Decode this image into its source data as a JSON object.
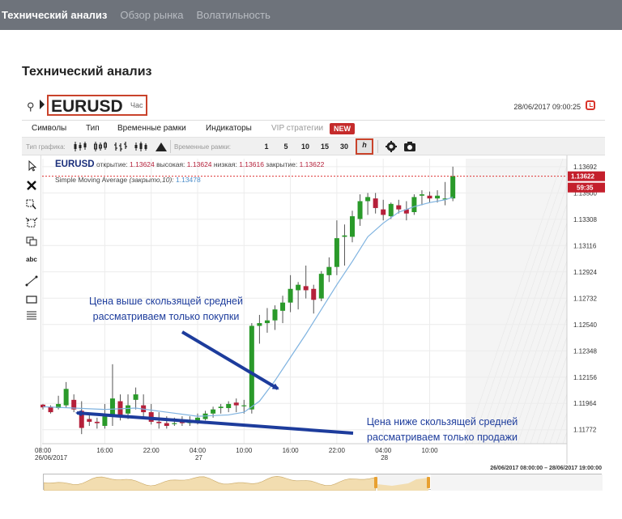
{
  "topnav": {
    "tabs": [
      {
        "label": "Технический анализ",
        "active": true
      },
      {
        "label": "Обзор рынка",
        "active": false
      },
      {
        "label": "Волатильность",
        "active": false
      }
    ]
  },
  "page_title": "Технический анализ",
  "widget": {
    "symbol": "EURUSD",
    "interval": "Час",
    "datetime": "28/06/2017 09:00:25",
    "menu": [
      "Символы",
      "Тип",
      "Временные рамки",
      "Индикаторы",
      "VIP стратегии"
    ],
    "new_badge": "NEW",
    "toolbar": {
      "chart_type_label": "Тип графика:",
      "timeframe_label": "Временные рамки:",
      "timeframes": [
        "1",
        "5",
        "10",
        "15",
        "30",
        "h"
      ],
      "selected_timeframe": "h"
    },
    "left_tools": [
      "cursor-icon",
      "cross-icon",
      "zoom-select-icon",
      "zoom-out-icon",
      "copy-icon",
      "text-tool",
      "trendline-icon",
      "rectangle-icon",
      "fib-icon"
    ],
    "text_tool_label": "abc"
  },
  "legend": {
    "symbol": "EURUSD",
    "open_label": "открытие:",
    "open": "1.13624",
    "high_label": "высокая:",
    "high": "1.13624",
    "low_label": "низкая:",
    "low": "1.13616",
    "close_label": "закрытие:",
    "close": "1.13622",
    "sma_label": "Simple Moving Average",
    "sma_params": "(закрыто,10)",
    "sma_value": "1.13478"
  },
  "price_tags": {
    "last": "1.13622",
    "countdown": "59:35"
  },
  "nav_range": "26/06/2017 08:00:00 – 28/06/2017 19:00:00",
  "annotations": {
    "upper": [
      "Цена выше скользящей средней",
      "рассматриваем только покупки"
    ],
    "lower": [
      "Цена ниже скользящей средней",
      "рассматриваем только продажи"
    ]
  },
  "colors": {
    "up": "#2a9a2a",
    "down": "#b5203a",
    "sma": "#7fb3e0",
    "arrow": "#1d3c9c",
    "accent": "#c9432b"
  },
  "chart_data": {
    "type": "candlestick",
    "symbol": "EURUSD",
    "y_ticks": [
      1.13692,
      1.135,
      1.13308,
      1.13116,
      1.12924,
      1.12732,
      1.1254,
      1.12348,
      1.12156,
      1.11964,
      1.11772
    ],
    "y_labels": [
      "1.13692",
      "1.13500",
      "1.13308",
      "1.13116",
      "1.12924",
      "1.12732",
      "1.12540",
      "1.12348",
      "1.12156",
      "1.11964",
      "1.11772"
    ],
    "ylim": [
      1.1167,
      1.1375
    ],
    "x_labels": [
      {
        "index": 0,
        "time": "08:00",
        "date": "26/06/2017"
      },
      {
        "index": 8,
        "time": "16:00",
        "date": ""
      },
      {
        "index": 14,
        "time": "22:00",
        "date": ""
      },
      {
        "index": 20,
        "time": "04:00",
        "date": "27"
      },
      {
        "index": 26,
        "time": "10:00",
        "date": ""
      },
      {
        "index": 32,
        "time": "16:00",
        "date": ""
      },
      {
        "index": 38,
        "time": "22:00",
        "date": ""
      },
      {
        "index": 44,
        "time": "04:00",
        "date": "28"
      },
      {
        "index": 50,
        "time": "10:00",
        "date": ""
      }
    ],
    "candles": [
      [
        1.11955,
        1.1196,
        1.11935,
        1.1192
      ],
      [
        1.1194,
        1.1195,
        1.119,
        1.1189
      ],
      [
        1.1193,
        1.1202,
        1.1196,
        1.1192
      ],
      [
        1.1195,
        1.1212,
        1.1207,
        1.1193
      ],
      [
        1.1199,
        1.1203,
        1.1192,
        1.119
      ],
      [
        1.1191,
        1.1198,
        1.11785,
        1.1174
      ],
      [
        1.1185,
        1.1189,
        1.1183,
        1.118
      ],
      [
        1.1183,
        1.1186,
        1.1182,
        1.1178
      ],
      [
        1.118,
        1.1196,
        1.1187,
        1.1178
      ],
      [
        1.1187,
        1.1225,
        1.12,
        1.118
      ],
      [
        1.1198,
        1.1203,
        1.1188,
        1.1184
      ],
      [
        1.1189,
        1.1203,
        1.1195,
        1.1185
      ],
      [
        1.1199,
        1.1208,
        1.1203,
        1.1192
      ],
      [
        1.1195,
        1.1203,
        1.119,
        1.1186
      ],
      [
        1.119,
        1.1196,
        1.1183,
        1.1181
      ],
      [
        1.1183,
        1.119,
        1.1182,
        1.1178
      ],
      [
        1.1182,
        1.1187,
        1.118,
        1.1178
      ],
      [
        1.1182,
        1.1186,
        1.1182,
        1.118
      ],
      [
        1.1183,
        1.1187,
        1.1182,
        1.118
      ],
      [
        1.1182,
        1.1187,
        1.1183,
        1.118
      ],
      [
        1.1183,
        1.1189,
        1.1186,
        1.1181
      ],
      [
        1.1185,
        1.1191,
        1.1189,
        1.1184
      ],
      [
        1.1189,
        1.1194,
        1.1192,
        1.1186
      ],
      [
        1.1193,
        1.1196,
        1.1194,
        1.1189
      ],
      [
        1.1193,
        1.1198,
        1.1196,
        1.119
      ],
      [
        1.1197,
        1.12,
        1.1195,
        1.119
      ],
      [
        1.1195,
        1.1199,
        1.1195,
        1.1189
      ],
      [
        1.1192,
        1.1255,
        1.1253,
        1.1189
      ],
      [
        1.1253,
        1.1261,
        1.1255,
        1.124
      ],
      [
        1.1255,
        1.1266,
        1.1257,
        1.1248
      ],
      [
        1.1257,
        1.1268,
        1.1265,
        1.125
      ],
      [
        1.1264,
        1.1275,
        1.127,
        1.1255
      ],
      [
        1.127,
        1.129,
        1.128,
        1.1263
      ],
      [
        1.1279,
        1.1285,
        1.1283,
        1.1265
      ],
      [
        1.1282,
        1.1297,
        1.1279,
        1.1273
      ],
      [
        1.128,
        1.1283,
        1.1272,
        1.1262
      ],
      [
        1.1273,
        1.1293,
        1.1291,
        1.1271
      ],
      [
        1.129,
        1.1303,
        1.1296,
        1.1285
      ],
      [
        1.1296,
        1.133,
        1.1317,
        1.129
      ],
      [
        1.1318,
        1.1327,
        1.1319,
        1.1297
      ],
      [
        1.1318,
        1.1337,
        1.1333,
        1.1314
      ],
      [
        1.1331,
        1.1349,
        1.1344,
        1.1326
      ],
      [
        1.1344,
        1.135,
        1.1347,
        1.1334
      ],
      [
        1.1346,
        1.135,
        1.1339,
        1.1335
      ],
      [
        1.1338,
        1.1345,
        1.1334,
        1.133
      ],
      [
        1.1333,
        1.1343,
        1.1342,
        1.1331
      ],
      [
        1.1341,
        1.1345,
        1.1338,
        1.1335
      ],
      [
        1.1338,
        1.1344,
        1.1335,
        1.133
      ],
      [
        1.1336,
        1.1349,
        1.1347,
        1.1334
      ],
      [
        1.1348,
        1.1352,
        1.1349,
        1.1341
      ],
      [
        1.1348,
        1.1351,
        1.1346,
        1.1343
      ],
      [
        1.1346,
        1.1352,
        1.1348,
        1.1343
      ],
      [
        1.1346,
        1.1358,
        1.1346,
        1.1341
      ],
      [
        1.1346,
        1.13692,
        1.13622,
        1.1344
      ]
    ],
    "sma": [
      [
        0,
        1.1194
      ],
      [
        4,
        1.1193
      ],
      [
        8,
        1.1192
      ],
      [
        12,
        1.1193
      ],
      [
        16,
        1.119
      ],
      [
        20,
        1.1187
      ],
      [
        24,
        1.1188
      ],
      [
        26,
        1.119
      ],
      [
        28,
        1.1198
      ],
      [
        30,
        1.1213
      ],
      [
        32,
        1.123
      ],
      [
        34,
        1.1247
      ],
      [
        36,
        1.1265
      ],
      [
        38,
        1.1283
      ],
      [
        40,
        1.13
      ],
      [
        42,
        1.1318
      ],
      [
        44,
        1.1328
      ],
      [
        46,
        1.1336
      ],
      [
        48,
        1.134
      ],
      [
        50,
        1.1343
      ],
      [
        52,
        1.1345
      ],
      [
        53,
        1.1347
      ]
    ],
    "current_price": 1.13622
  }
}
